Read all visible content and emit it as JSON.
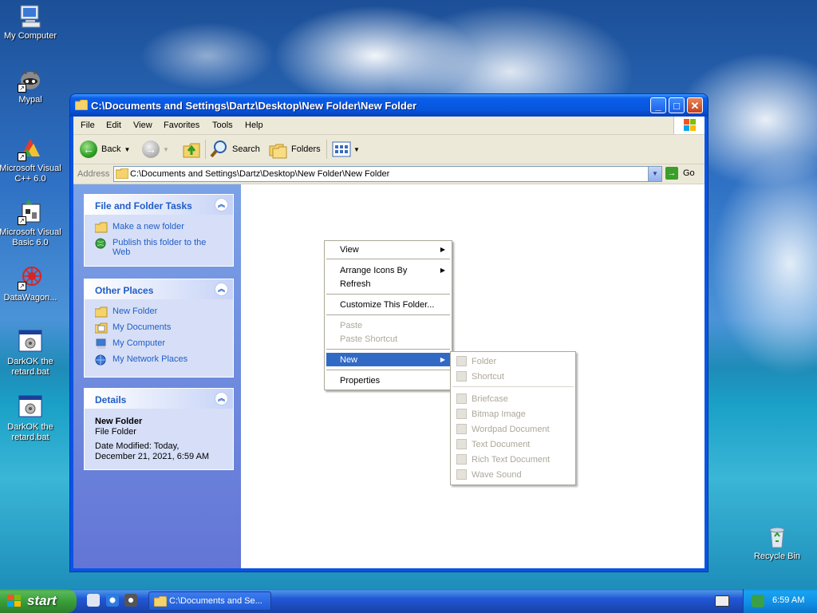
{
  "desktop": {
    "icons": [
      {
        "label": "My Computer"
      },
      {
        "label": "Mypal"
      },
      {
        "label": "Microsoft Visual C++ 6.0"
      },
      {
        "label": "Microsoft Visual Basic 6.0"
      },
      {
        "label": "DataWagon..."
      },
      {
        "label": "DarkOK the retard.bat"
      },
      {
        "label": "DarkOK the retard.bat"
      },
      {
        "label": "Recycle Bin"
      }
    ]
  },
  "window": {
    "title": "C:\\Documents and Settings\\Dartz\\Desktop\\New Folder\\New Folder",
    "menu": [
      "File",
      "Edit",
      "View",
      "Favorites",
      "Tools",
      "Help"
    ],
    "toolbar": {
      "back": "Back",
      "search": "Search",
      "folders": "Folders"
    },
    "address": {
      "label": "Address",
      "value": "C:\\Documents and Settings\\Dartz\\Desktop\\New Folder\\New Folder",
      "go": "Go"
    },
    "tasks_panel": {
      "title": "File and Folder Tasks",
      "links": [
        "Make a new folder",
        "Publish this folder to the Web"
      ]
    },
    "places_panel": {
      "title": "Other Places",
      "links": [
        "New Folder",
        "My Documents",
        "My Computer",
        "My Network Places"
      ]
    },
    "details_panel": {
      "title": "Details",
      "name": "New Folder",
      "type": "File Folder",
      "modified_line1": "Date Modified: Today,",
      "modified_line2": "December 21, 2021, 6:59 AM"
    }
  },
  "context_menu": {
    "items": [
      {
        "label": "View",
        "submenu": true,
        "enabled": true
      },
      {
        "label": "Arrange Icons By",
        "submenu": true,
        "enabled": true
      },
      {
        "label": "Refresh",
        "enabled": true
      },
      {
        "label": "Customize This Folder...",
        "enabled": true
      },
      {
        "label": "Paste",
        "enabled": false
      },
      {
        "label": "Paste Shortcut",
        "enabled": false
      },
      {
        "label": "New",
        "submenu": true,
        "enabled": true,
        "highlighted": true
      },
      {
        "label": "Properties",
        "enabled": true
      }
    ],
    "new_submenu": [
      "Folder",
      "Shortcut",
      "Briefcase",
      "Bitmap Image",
      "Wordpad Document",
      "Text Document",
      "Rich Text Document",
      "Wave Sound"
    ]
  },
  "taskbar": {
    "start": "start",
    "task_button": "C:\\Documents and Se...",
    "clock": "6:59 AM"
  },
  "colors": {
    "selection": "#316ac5",
    "titlebar": "#0755dd",
    "taskpane_link": "#215dc6"
  }
}
